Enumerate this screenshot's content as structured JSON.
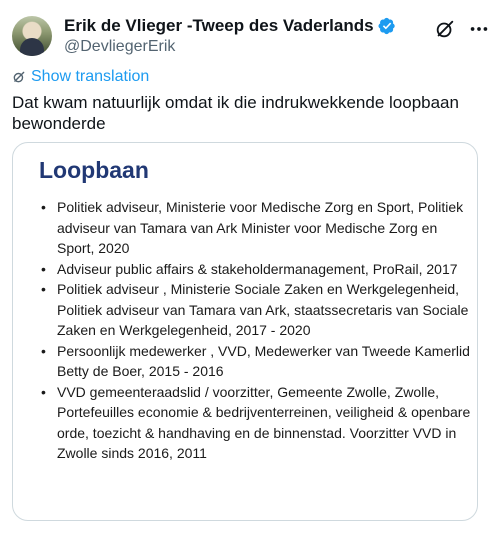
{
  "author": {
    "display_name": "Erik de Vlieger -Tweep des Vaderlands",
    "handle": "@DevliegerErik",
    "verified": true,
    "verified_color": "#1d9bf0"
  },
  "actions": {
    "grok_icon": "grok-icon",
    "more_icon": "more-icon"
  },
  "translate": {
    "label": "Show translation",
    "color": "#1d9bf0"
  },
  "tweet": {
    "text": "Dat kwam natuurlijk omdat ik die indrukwekkende loopbaan bewonderde"
  },
  "card": {
    "title": "Loopbaan",
    "title_color": "#213874",
    "items": [
      {
        "text": "Politiek adviseur, Ministerie voor Medische Zorg en Sport, Politiek adviseur van Tamara van Ark Minister voor Medische Zorg en Sport, 2020"
      },
      {
        "text": "Adviseur public affairs & stakeholdermanagement, ProRail, 2017"
      },
      {
        "text": "Politiek adviseur , Ministerie Sociale Zaken en Werkgelegenheid, Politiek adviseur van Tamara van Ark, staatssecretaris van Sociale Zaken en Werkgelegenheid, 2017 - 2020"
      },
      {
        "text": "Persoonlijk medewerker , VVD, Medewerker van Tweede Kamerlid Betty de Boer, 2015 - 2016"
      },
      {
        "text": "VVD gemeenteraadslid / voorzitter, Gemeente Zwolle, Zwolle, Portefeuilles economie & bedrijventerreinen, veiligheid & openbare orde, toezicht & handhaving en de binnenstad. Voorzitter VVD in Zwolle sinds 2016, 2011"
      }
    ]
  }
}
